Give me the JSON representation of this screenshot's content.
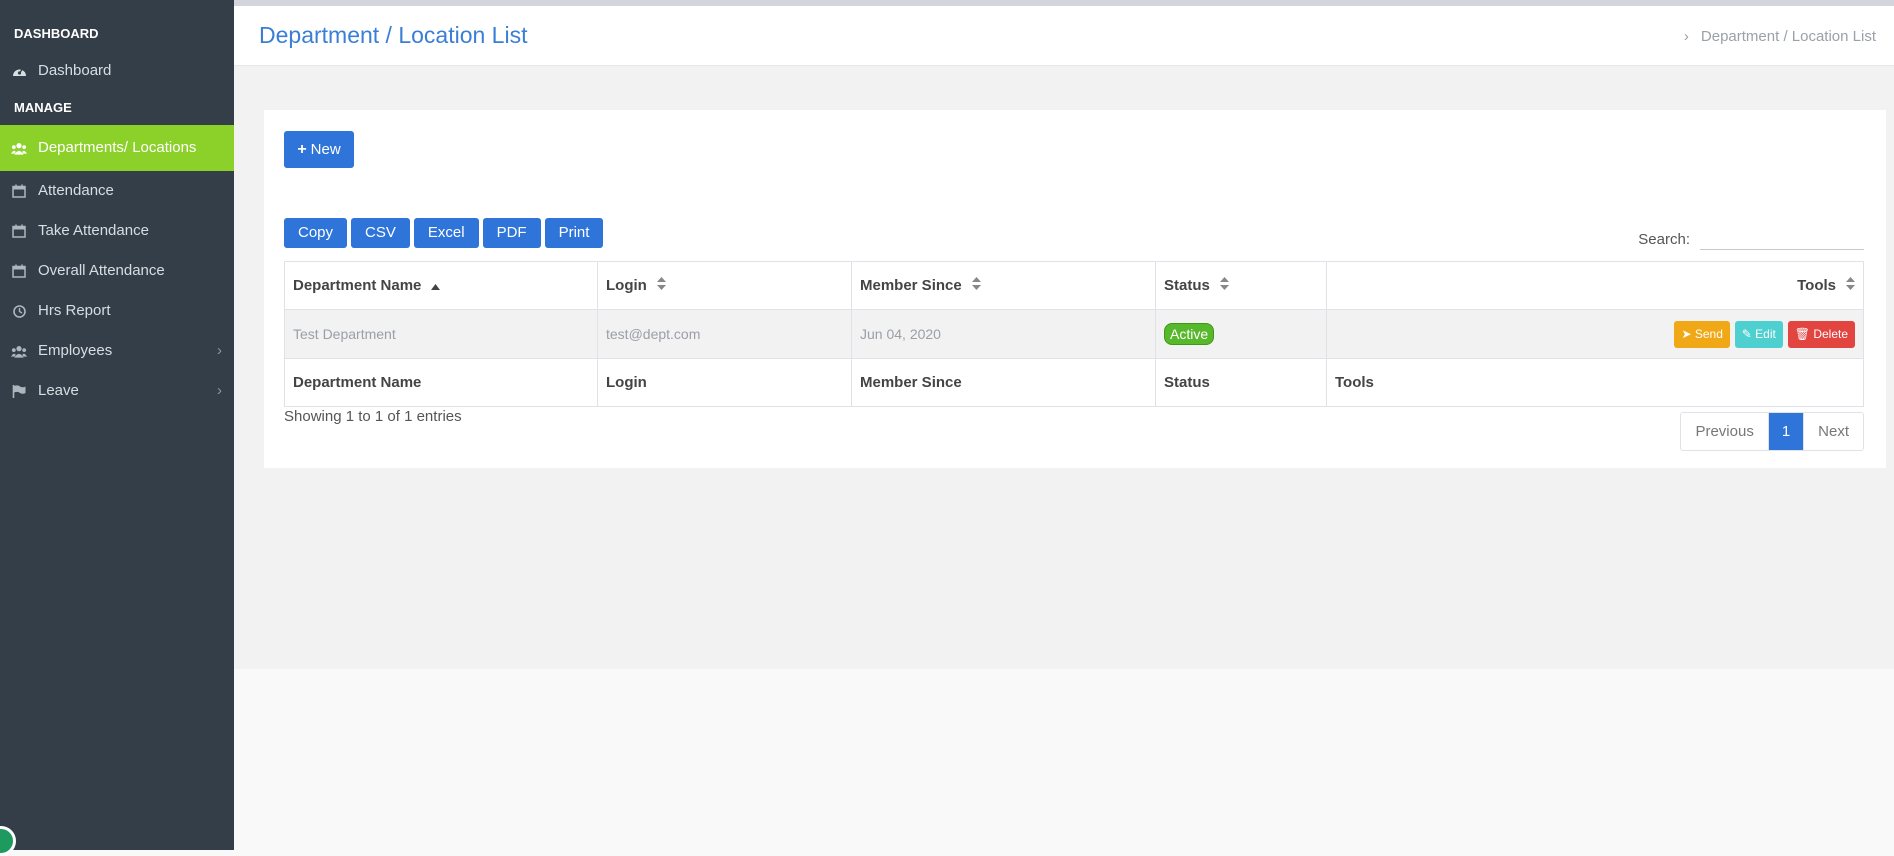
{
  "sidebar": {
    "header_dashboard": "DASHBOARD",
    "header_manage": "MANAGE",
    "items": [
      {
        "label": "Dashboard",
        "icon": "dashboard-icon"
      },
      {
        "label": "Departments/ Locations",
        "icon": "users-icon",
        "active": true
      },
      {
        "label": "Attendance",
        "icon": "calendar-icon"
      },
      {
        "label": "Take Attendance",
        "icon": "calendar-icon"
      },
      {
        "label": "Overall Attendance",
        "icon": "calendar-icon"
      },
      {
        "label": "Hrs Report",
        "icon": "clock-icon"
      },
      {
        "label": "Employees",
        "icon": "users-icon",
        "has_submenu": true
      },
      {
        "label": "Leave",
        "icon": "flag-icon",
        "has_submenu": true
      }
    ]
  },
  "header": {
    "title": "Department / Location List",
    "breadcrumb": "Department / Location List"
  },
  "toolbar": {
    "new_label": "New",
    "export_buttons": [
      "Copy",
      "CSV",
      "Excel",
      "PDF",
      "Print"
    ],
    "search_label": "Search:",
    "search_value": ""
  },
  "table": {
    "columns": [
      "Department Name",
      "Login",
      "Member Since",
      "Status",
      "Tools"
    ],
    "rows": [
      {
        "name": "Test Department",
        "login": "test@dept.com",
        "member_since": "Jun 04, 2020",
        "status": "Active"
      }
    ],
    "tools": {
      "send": "Send",
      "edit": "Edit",
      "delete": "Delete"
    },
    "footer_columns": [
      "Department Name",
      "Login",
      "Member Since",
      "Status",
      "Tools"
    ]
  },
  "pagination": {
    "info": "Showing 1 to 1 of 1 entries",
    "previous": "Previous",
    "current": "1",
    "next": "Next"
  },
  "colors": {
    "sidebar_bg": "#343e48",
    "active_item": "#8cd12a",
    "primary": "#2f74d8",
    "title": "#3a7fd5",
    "send": "#f0a816",
    "edit": "#4dd0cf",
    "delete": "#e2443f",
    "status_active": "#58b82c"
  }
}
